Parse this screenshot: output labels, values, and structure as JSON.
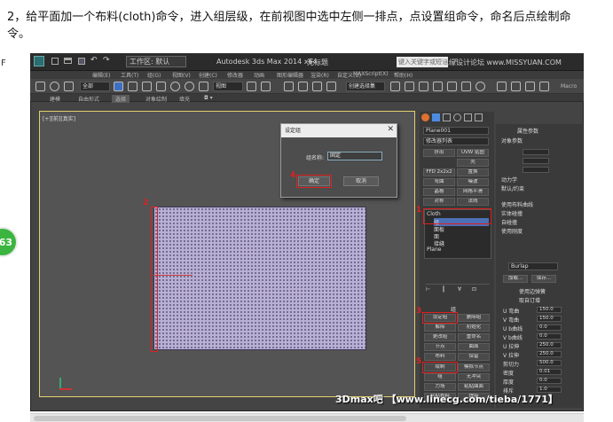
{
  "instruction": "2，给平面加一个布料(cloth)命令，进入组层级，在前视图中选中左侧一排点，点设置组命令，命名后点绘制命令。",
  "edge_letter": "F",
  "badge": "63",
  "titlebar": {
    "workspace": "工作区: 默认",
    "app_title": "Autodesk 3ds Max  2014 x64",
    "doc_title": "无标题",
    "search_placeholder": "键入关键字或短语"
  },
  "menubar": [
    "编辑(E)",
    "工具(T)",
    "组(G)",
    "视图(V)",
    "创建(C)",
    "修改器",
    "动画",
    "图形编辑器",
    "渲染(R)",
    "自定义(U)",
    "MAXScript(X)",
    "帮助(H)"
  ],
  "toolbar": {
    "filter": "全部",
    "coord": "视图",
    "selset": "创建选择集",
    "macro": "Macro"
  },
  "ribbon": [
    "建模",
    "自由形式",
    "选择",
    "对象绘制",
    "填充"
  ],
  "viewport": {
    "label": "[+][前][真实]"
  },
  "annotations": {
    "n1": "1",
    "n2": "2",
    "n3": "3",
    "n4": "4",
    "n5": "5"
  },
  "dialog": {
    "title": "设定组",
    "label": "组名称:",
    "value": "固定",
    "ok": "确定",
    "cancel": "取消"
  },
  "command_panel": {
    "object_name": "Plane001",
    "modifier_list": "修改器列表",
    "buttons": [
      "挤出",
      "UVW 贴图",
      "壳",
      "FFD 2x2x2",
      "置换",
      "弯曲",
      "噪波",
      "晶格",
      "网格平滑",
      "对称",
      "法线"
    ],
    "stack": [
      "Cloth",
      "组",
      "面板",
      "面",
      "接缝",
      "Plane"
    ],
    "group_header": "组",
    "group_buttons": [
      "设定组",
      "删除组",
      "解除",
      "初始化",
      "更改组",
      "重命名",
      "节点",
      "曲面",
      "布料",
      "保留",
      "绘制",
      "模拟节点",
      "组",
      "无冲突",
      "力场",
      "粘贴曲面",
      "粘贴布料",
      "焊接"
    ]
  },
  "right_panel": {
    "header": "属性参数",
    "sub": "对象参数",
    "rows": [
      "U 弯曲",
      "V 弯曲",
      "U b曲线",
      "V b曲线",
      "U 拉伸",
      "V 拉伸",
      "剪切力",
      "密度",
      "厚度",
      "排斥"
    ],
    "values": [
      "150.0",
      "150.0",
      "0.0",
      "0.0",
      "250.0",
      "250.0",
      "500.0",
      "0.01",
      "0.0",
      "1.0"
    ],
    "preset": "Burlap",
    "load": "加载...",
    "save": "保存...",
    "use_edge": "使用边弹簧",
    "set_from": "取自订增",
    "check_labels": [
      "使用布料曲线",
      "实体碰撞",
      "自碰撞",
      "使用刚度"
    ],
    "misc": [
      "动力学",
      "默认/约束"
    ]
  },
  "watermark": "3Dmax吧 【www.linecg.com/tieba/1771】",
  "watermark_top": "思缘设计论坛 www.MISSYUAN.COM"
}
